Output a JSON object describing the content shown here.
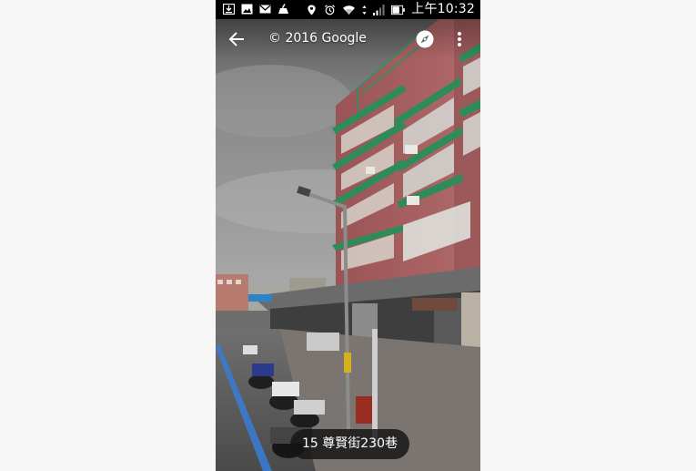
{
  "status_bar": {
    "time": "上午10:32",
    "left_icons": [
      "download-icon",
      "image-icon",
      "gmail-icon",
      "cleaner-icon"
    ],
    "right_icons": [
      "location-icon",
      "alarm-icon",
      "wifi-icon",
      "signal-icon",
      "battery-icon"
    ]
  },
  "toolbar": {
    "copyright": "© 2016 Google",
    "back_icon": "arrow-back-icon",
    "compass_icon": "compass-icon",
    "menu_icon": "more-vert-icon"
  },
  "address": {
    "label": "15 尊賢街230巷"
  },
  "colors": {
    "status_bar_bg": "#000000",
    "building_brick": "#a0595a",
    "awning_green": "#2e8c5a",
    "sky": "#8e8e8e",
    "chip_bg": "#141414"
  }
}
